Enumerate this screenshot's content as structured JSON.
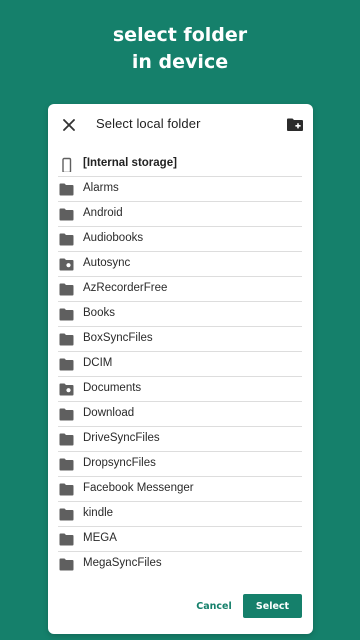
{
  "headline": {
    "line1": "select folder",
    "line2": "in device"
  },
  "dialog": {
    "title": "Select local folder",
    "close_icon": "close-icon",
    "new_folder_icon": "create-new-folder-icon"
  },
  "storage": {
    "label": "[Internal storage]",
    "icon": "phone-icon"
  },
  "folders": [
    {
      "label": "Alarms",
      "icon": "folder-icon"
    },
    {
      "label": "Android",
      "icon": "folder-icon"
    },
    {
      "label": "Audiobooks",
      "icon": "folder-icon"
    },
    {
      "label": "Autosync",
      "icon": "synced-folder-icon"
    },
    {
      "label": "AzRecorderFree",
      "icon": "folder-icon"
    },
    {
      "label": "Books",
      "icon": "folder-icon"
    },
    {
      "label": "BoxSyncFiles",
      "icon": "folder-icon"
    },
    {
      "label": "DCIM",
      "icon": "folder-icon"
    },
    {
      "label": "Documents",
      "icon": "synced-folder-icon"
    },
    {
      "label": "Download",
      "icon": "folder-icon"
    },
    {
      "label": "DriveSyncFiles",
      "icon": "folder-icon"
    },
    {
      "label": "DropsyncFiles",
      "icon": "folder-icon"
    },
    {
      "label": "Facebook Messenger",
      "icon": "folder-icon"
    },
    {
      "label": "kindle",
      "icon": "folder-icon"
    },
    {
      "label": "MEGA",
      "icon": "folder-icon"
    },
    {
      "label": "MegaSyncFiles",
      "icon": "folder-icon"
    }
  ],
  "actions": {
    "cancel_label": "Cancel",
    "select_label": "Select"
  },
  "colors": {
    "accent": "#15806b",
    "icon": "#5f5f5f",
    "divider": "#dddddd"
  }
}
